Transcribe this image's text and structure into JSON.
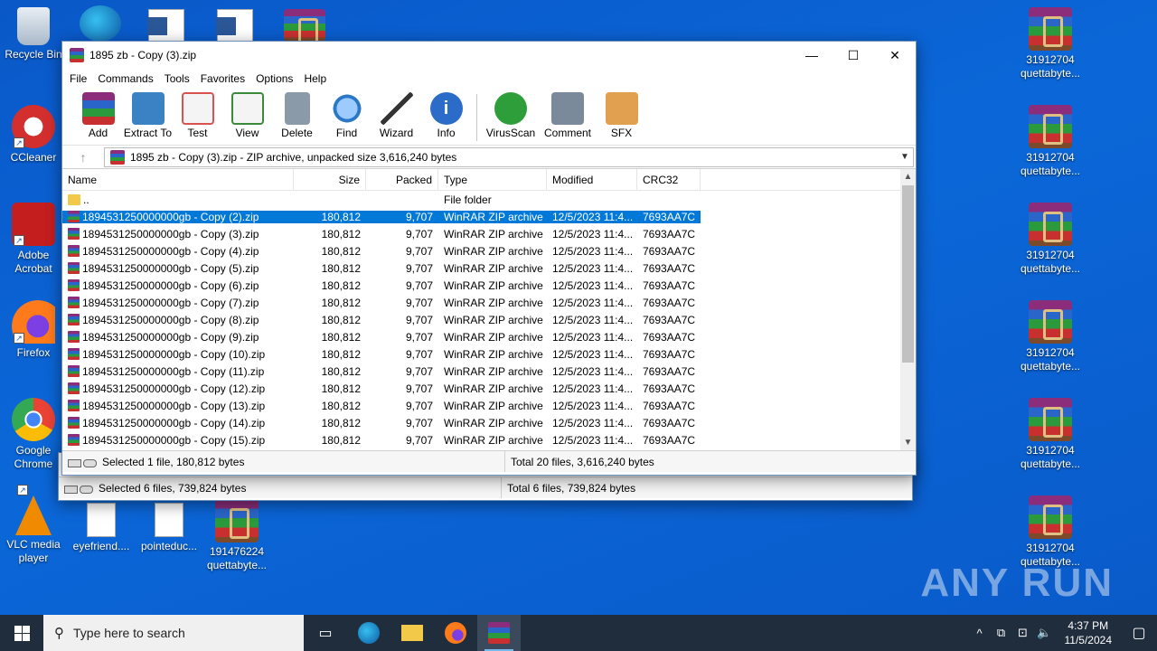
{
  "desktop": {
    "left_icons": [
      {
        "label": "Recycle Bin",
        "icon": "recycle-bin-icon"
      },
      {
        "label": "CCleaner",
        "icon": "ccleaner-icon"
      },
      {
        "label": "Adobe Acrobat",
        "icon": "acrobat-icon"
      },
      {
        "label": "Firefox",
        "icon": "firefox-icon"
      },
      {
        "label": "Google Chrome",
        "icon": "chrome-icon"
      },
      {
        "label": "VLC media player",
        "icon": "vlc-icon"
      }
    ],
    "bottom_icons": [
      {
        "label": "eyefriend...."
      },
      {
        "label": "pointeduc..."
      },
      {
        "label": "191476224 quettabyte..."
      }
    ],
    "right_icons": [
      {
        "label": "31912704 quettabyte..."
      },
      {
        "label": "31912704 quettabyte..."
      },
      {
        "label": "31912704 quettabyte..."
      },
      {
        "label": "31912704 quettabyte..."
      },
      {
        "label": "31912704 quettabyte..."
      },
      {
        "label": "31912704 quettabyte..."
      }
    ],
    "watermark": "ANY RUN"
  },
  "back_window": {
    "status_left": "Selected 6 files, 739,824 bytes",
    "status_right": "Total 6 files, 739,824 bytes"
  },
  "window": {
    "title": "1895 zb - Copy (3).zip",
    "menu": [
      "File",
      "Commands",
      "Tools",
      "Favorites",
      "Options",
      "Help"
    ],
    "toolbar": [
      {
        "label": "Add",
        "color": "#c0392b"
      },
      {
        "label": "Extract To",
        "color": "#3b82c4"
      },
      {
        "label": "Test",
        "color": "#d9534f"
      },
      {
        "label": "View",
        "color": "#3a8a3a"
      },
      {
        "label": "Delete",
        "color": "#8a9aa8"
      },
      {
        "label": "Find",
        "color": "#2b78c8"
      },
      {
        "label": "Wizard",
        "color": "#6a5acd"
      },
      {
        "label": "Info",
        "color": "#2b6cc8"
      }
    ],
    "toolbar2": [
      {
        "label": "VirusScan",
        "color": "#2e9e3a"
      },
      {
        "label": "Comment",
        "color": "#7a8a9a"
      },
      {
        "label": "SFX",
        "color": "#e08a2a"
      }
    ],
    "address": "1895 zb - Copy (3).zip - ZIP archive, unpacked size 3,616,240 bytes",
    "columns": [
      "Name",
      "Size",
      "Packed",
      "Type",
      "Modified",
      "CRC32"
    ],
    "parent_row": {
      "name": "..",
      "type": "File folder"
    },
    "rows": [
      {
        "name": "1894531250000000gb - Copy (2).zip",
        "size": "180,812",
        "packed": "9,707",
        "type": "WinRAR ZIP archive",
        "modified": "12/5/2023 11:4...",
        "crc": "7693AA7C",
        "selected": true
      },
      {
        "name": "1894531250000000gb - Copy (3).zip",
        "size": "180,812",
        "packed": "9,707",
        "type": "WinRAR ZIP archive",
        "modified": "12/5/2023 11:4...",
        "crc": "7693AA7C"
      },
      {
        "name": "1894531250000000gb - Copy (4).zip",
        "size": "180,812",
        "packed": "9,707",
        "type": "WinRAR ZIP archive",
        "modified": "12/5/2023 11:4...",
        "crc": "7693AA7C"
      },
      {
        "name": "1894531250000000gb - Copy (5).zip",
        "size": "180,812",
        "packed": "9,707",
        "type": "WinRAR ZIP archive",
        "modified": "12/5/2023 11:4...",
        "crc": "7693AA7C"
      },
      {
        "name": "1894531250000000gb - Copy (6).zip",
        "size": "180,812",
        "packed": "9,707",
        "type": "WinRAR ZIP archive",
        "modified": "12/5/2023 11:4...",
        "crc": "7693AA7C"
      },
      {
        "name": "1894531250000000gb - Copy (7).zip",
        "size": "180,812",
        "packed": "9,707",
        "type": "WinRAR ZIP archive",
        "modified": "12/5/2023 11:4...",
        "crc": "7693AA7C"
      },
      {
        "name": "1894531250000000gb - Copy (8).zip",
        "size": "180,812",
        "packed": "9,707",
        "type": "WinRAR ZIP archive",
        "modified": "12/5/2023 11:4...",
        "crc": "7693AA7C"
      },
      {
        "name": "1894531250000000gb - Copy (9).zip",
        "size": "180,812",
        "packed": "9,707",
        "type": "WinRAR ZIP archive",
        "modified": "12/5/2023 11:4...",
        "crc": "7693AA7C"
      },
      {
        "name": "1894531250000000gb - Copy (10).zip",
        "size": "180,812",
        "packed": "9,707",
        "type": "WinRAR ZIP archive",
        "modified": "12/5/2023 11:4...",
        "crc": "7693AA7C"
      },
      {
        "name": "1894531250000000gb - Copy (11).zip",
        "size": "180,812",
        "packed": "9,707",
        "type": "WinRAR ZIP archive",
        "modified": "12/5/2023 11:4...",
        "crc": "7693AA7C"
      },
      {
        "name": "1894531250000000gb - Copy (12).zip",
        "size": "180,812",
        "packed": "9,707",
        "type": "WinRAR ZIP archive",
        "modified": "12/5/2023 11:4...",
        "crc": "7693AA7C"
      },
      {
        "name": "1894531250000000gb - Copy (13).zip",
        "size": "180,812",
        "packed": "9,707",
        "type": "WinRAR ZIP archive",
        "modified": "12/5/2023 11:4...",
        "crc": "7693AA7C"
      },
      {
        "name": "1894531250000000gb - Copy (14).zip",
        "size": "180,812",
        "packed": "9,707",
        "type": "WinRAR ZIP archive",
        "modified": "12/5/2023 11:4...",
        "crc": "7693AA7C"
      },
      {
        "name": "1894531250000000gb - Copy (15).zip",
        "size": "180,812",
        "packed": "9,707",
        "type": "WinRAR ZIP archive",
        "modified": "12/5/2023 11:4...",
        "crc": "7693AA7C"
      }
    ],
    "status_left": "Selected 1 file, 180,812 bytes",
    "status_right": "Total 20 files, 3,616,240 bytes"
  },
  "taskbar": {
    "search_placeholder": "Type here to search",
    "time": "4:37 PM",
    "date": "11/5/2024"
  }
}
